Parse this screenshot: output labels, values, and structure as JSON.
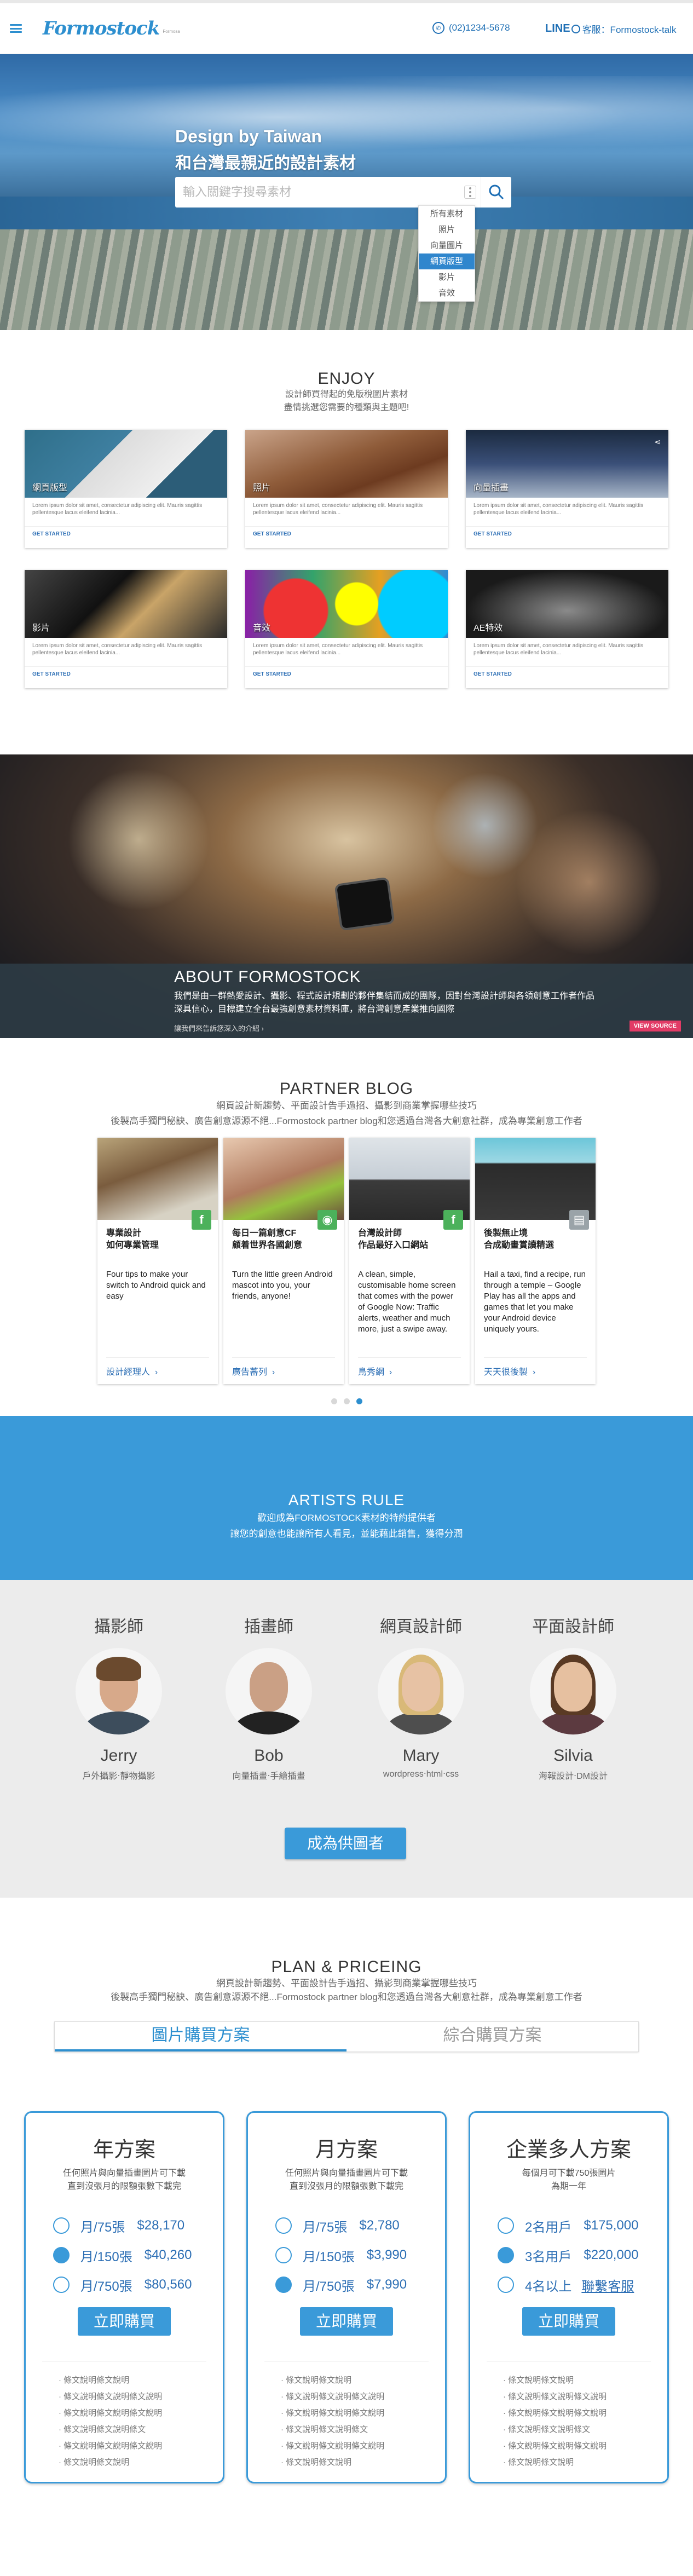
{
  "header": {
    "logo": "Formostock",
    "logo_tag": "Formosa",
    "phone": "(02)1234-5678",
    "line_brand": "LINE",
    "line_label": "客服：Formostock-talk"
  },
  "hero": {
    "title1": "Design by Taiwan",
    "title2": "和台灣最親近的設計素材",
    "search_placeholder": "輸入關鍵字搜尋素材",
    "dropdown": [
      "所有素材",
      "照片",
      "向量圖片",
      "網頁版型",
      "影片",
      "音效"
    ],
    "dropdown_selected": "網頁版型"
  },
  "enjoy": {
    "title": "ENJOY",
    "sub1": "設計師買得起的免版稅圖片素材",
    "sub2": "盡情挑選您需要的種類與主題吧!",
    "cards": [
      {
        "caption": "網頁版型",
        "text": "Lorem ipsum dolor sit amet, consectetur adipiscing elit. Mauris sagittis pellentesque lacus eleifend lacinia...",
        "more": "GET STARTED"
      },
      {
        "caption": "照片",
        "text": "Lorem ipsum dolor sit amet, consectetur adipiscing elit. Mauris sagittis pellentesque lacus eleifend lacinia...",
        "more": "GET STARTED"
      },
      {
        "caption": "向量插畫",
        "text": "Lorem ipsum dolor sit amet, consectetur adipiscing elit. Mauris sagittis pellentesque lacus eleifend lacinia...",
        "more": "GET STARTED"
      },
      {
        "caption": "影片",
        "text": "Lorem ipsum dolor sit amet, consectetur adipiscing elit. Mauris sagittis pellentesque lacus eleifend lacinia...",
        "more": "GET STARTED"
      },
      {
        "caption": "音效",
        "text": "Lorem ipsum dolor sit amet, consectetur adipiscing elit. Mauris sagittis pellentesque lacus eleifend lacinia...",
        "more": "GET STARTED"
      },
      {
        "caption": "AE特效",
        "text": "Lorem ipsum dolor sit amet, consectetur adipiscing elit. Mauris sagittis pellentesque lacus eleifend lacinia...",
        "more": "GET STARTED"
      }
    ]
  },
  "about": {
    "title": "ABOUT FORMOSTOCK",
    "desc": "我們是由一群熱愛設計、攝影、程式設計規劃的夥伴集結而成的團隊，因對台灣設計師與各領創意工作者作品深具信心，目標建立全台最強創意素材資料庫，將台灣創意產業推向國際",
    "link": "讓我們來告訴您深入的介紹 ›",
    "view_source": "VIEW SOURCE"
  },
  "blog": {
    "title": "PARTNER BLOG",
    "sub1": "網頁設計新趨勢、平面設計告手過招、攝影到商業掌握哪些技巧",
    "sub2": "後製高手獨門秘訣、廣告創意源源不絕...Formostock partner blog和您透過台灣各大創意社群，成為專業創意工作者",
    "posts": [
      {
        "title": "專業設計\n如何專業管理",
        "desc": "Four tips to make your switch to Android quick and easy",
        "foot": "設計經理人"
      },
      {
        "title": "每日一篇創意CF\n顧着世界各國創意",
        "desc": "Turn the little green Android mascot into you, your friends, anyone!",
        "foot": "廣告蕃列"
      },
      {
        "title": "台灣設計師\n作品最好入口網站",
        "desc": "A clean, simple, customisable home screen that comes with the power of Google Now: Traffic alerts, weather and much more, just a swipe away.",
        "foot": "鳥秀網"
      },
      {
        "title": "後製無止境\n合成動畫賞讀精選",
        "desc": "Hail a taxi, find a recipe, run through a temple – Google Play has all the apps and games that let you make your Android device uniquely yours.",
        "foot": "天天很後製"
      }
    ]
  },
  "artists": {
    "title": "ARTISTS RULE",
    "sub1": "歡迎成為FORMOSTOCK素材的特約提供者",
    "sub2": "讓您的創意也能讓所有人看見，並能藉此銷售，獲得分潤",
    "people": [
      {
        "role": "攝影師",
        "name": "Jerry",
        "desc": "戶外攝影‧靜物攝影"
      },
      {
        "role": "插畫師",
        "name": "Bob",
        "desc": "向量插畫‧手繪插畫"
      },
      {
        "role": "網頁設計師",
        "name": "Mary",
        "desc": "wordpress‧html‧css"
      },
      {
        "role": "平面設計師",
        "name": "Silvia",
        "desc": "海報設計‧DM設計"
      }
    ],
    "apply": "成為供圖者"
  },
  "plan": {
    "title": "PLAN & PRICEING",
    "sub1": "網頁設計新趨勢、平面設計告手過招、攝影到商業掌握哪些技巧",
    "sub2": "後製高手獨門秘訣、廣告創意源源不絕...Formostock partner blog和您透過台灣各大創意社群，成為專業創意工作者",
    "tabs": [
      "圖片購買方案",
      "綜合購買方案"
    ],
    "cards": [
      {
        "name": "年方案",
        "desc": "任何照片與向量插畫圖片可下載\n直到沒張月的限額張數下載完",
        "options": [
          {
            "label": "月/75張",
            "price": "$28,170",
            "selected": false
          },
          {
            "label": "月/150張",
            "price": "$40,260",
            "selected": true
          },
          {
            "label": "月/750張",
            "price": "$80,560",
            "selected": false
          }
        ],
        "buy": "立即購買",
        "features": [
          "條文說明條文說明",
          "條文說明條文說明條文說明",
          "條文說明條文說明條文說明",
          "條文說明條文說明條文",
          "條文說明條文說明條文說明",
          "條文說明條文說明"
        ]
      },
      {
        "name": "月方案",
        "desc": "任何照片與向量插畫圖片可下載\n直到沒張月的限額張數下載完",
        "options": [
          {
            "label": "月/75張",
            "price": "$2,780",
            "selected": false
          },
          {
            "label": "月/150張",
            "price": "$3,990",
            "selected": false
          },
          {
            "label": "月/750張",
            "price": "$7,990",
            "selected": true
          }
        ],
        "buy": "立即購買",
        "features": [
          "條文說明條文說明",
          "條文說明條文說明條文說明",
          "條文說明條文說明條文說明",
          "條文說明條文說明條文",
          "條文說明條文說明條文說明",
          "條文說明條文說明"
        ]
      },
      {
        "name": "企業多人方案",
        "desc": "每個月可下載750張圖片\n為期一年",
        "options": [
          {
            "label": "2名用戶",
            "price": "$175,000",
            "selected": false
          },
          {
            "label": "3名用戶",
            "price": "$220,000",
            "selected": true
          },
          {
            "label": "4名以上",
            "price": "聯繫客服",
            "selected": false,
            "link": true
          }
        ],
        "buy": "立即購買",
        "features": [
          "條文說明條文說明",
          "條文說明條文說明條文說明",
          "條文說明條文說明條文說明",
          "條文說明條文說明條文",
          "條文說明條文說明條文說明",
          "條文說明條文說明"
        ]
      }
    ]
  },
  "colors": {
    "brand": "#2d8fcf",
    "accent_pink": "#e23b66",
    "artists_band": "#3a9ad9"
  }
}
